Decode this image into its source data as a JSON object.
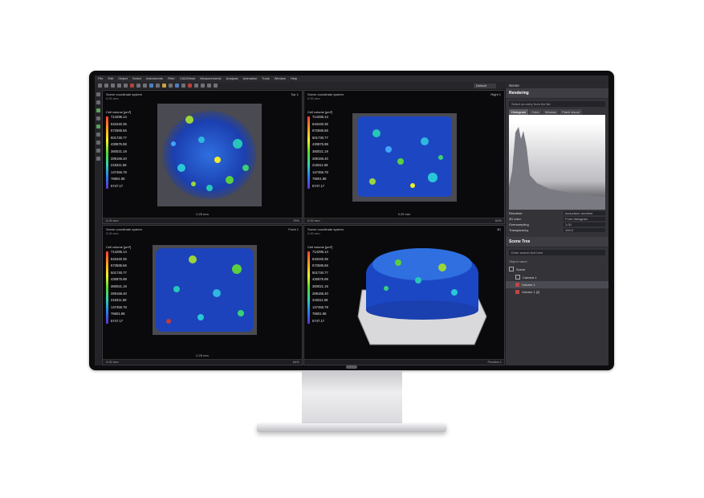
{
  "menu": [
    "File",
    "Edit",
    "Object",
    "Select",
    "Instruments",
    "Filter",
    "CAD/Mesh",
    "Measurements",
    "Analysis",
    "Animation",
    "Tools",
    "Window",
    "Help"
  ],
  "toolbar": {
    "mode_select": "Default"
  },
  "viewports": [
    {
      "title": "Scene coordinate system",
      "subtitle": "0.00 mm",
      "name": "Top 1",
      "foot_left": "0.00 mm",
      "foot_right": "75%",
      "scale": "0.25 mm"
    },
    {
      "title": "Scene coordinate system",
      "subtitle": "0.00 mm",
      "name": "Right 1",
      "foot_left": "0.00 mm",
      "foot_right": "64%",
      "scale": "0.25 mm"
    },
    {
      "title": "Scene coordinate system",
      "subtitle": "0.00 mm",
      "name": "Front 1",
      "foot_left": "0.00 mm",
      "foot_right": "64%",
      "scale": "0.25 mm"
    },
    {
      "title": "Scene coordinate system",
      "subtitle": "0.00 mm",
      "name": "3D",
      "foot_left": "",
      "foot_right": "Preview 1",
      "scale": ""
    }
  ],
  "legend": {
    "title": "Cell volume [µm³]",
    "values": [
      "714295.14",
      "643440.35",
      "572585.56",
      "501730.77",
      "430875.98",
      "360021.19",
      "289166.40",
      "218311.59",
      "147456.78",
      "76601.98",
      "5747.17"
    ]
  },
  "panel": {
    "scene_label": "Scene",
    "rendering_title": "Rendering",
    "select_placeholder": "Select an entry from the list",
    "tabs": [
      "Histogram",
      "Color",
      "Window",
      "Patch visual"
    ],
    "props": [
      {
        "label": "Renderer",
        "value": "Isosurface renderer"
      },
      {
        "label": "3D color",
        "value": "From histogram"
      },
      {
        "label": "Oversampling",
        "value": "1.00"
      },
      {
        "label": "Transparency",
        "value": "100.0"
      }
    ],
    "scene_tree_title": "Scene Tree",
    "search_placeholder": "Enter search text here",
    "object_name_header": "Object name",
    "tree": [
      "Scene",
      "Camera 1",
      "Volume 1",
      "Volume 1 [2]"
    ]
  }
}
